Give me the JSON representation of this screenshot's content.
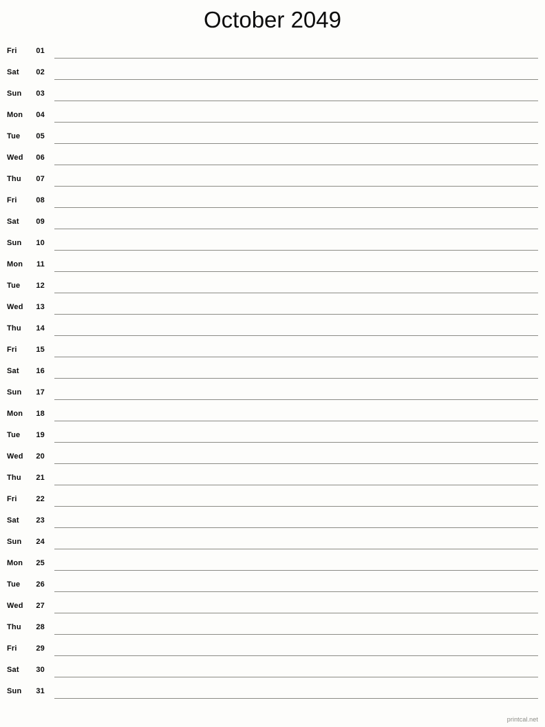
{
  "title": "October 2049",
  "month": "October",
  "year": "2049",
  "footer": {
    "credit": "printcal.net"
  },
  "calendar": {
    "columns": [
      "weekday",
      "day",
      "notes"
    ],
    "rows": [
      {
        "weekday": "Fri",
        "day": "01",
        "note": ""
      },
      {
        "weekday": "Sat",
        "day": "02",
        "note": ""
      },
      {
        "weekday": "Sun",
        "day": "03",
        "note": ""
      },
      {
        "weekday": "Mon",
        "day": "04",
        "note": ""
      },
      {
        "weekday": "Tue",
        "day": "05",
        "note": ""
      },
      {
        "weekday": "Wed",
        "day": "06",
        "note": ""
      },
      {
        "weekday": "Thu",
        "day": "07",
        "note": ""
      },
      {
        "weekday": "Fri",
        "day": "08",
        "note": ""
      },
      {
        "weekday": "Sat",
        "day": "09",
        "note": ""
      },
      {
        "weekday": "Sun",
        "day": "10",
        "note": ""
      },
      {
        "weekday": "Mon",
        "day": "11",
        "note": ""
      },
      {
        "weekday": "Tue",
        "day": "12",
        "note": ""
      },
      {
        "weekday": "Wed",
        "day": "13",
        "note": ""
      },
      {
        "weekday": "Thu",
        "day": "14",
        "note": ""
      },
      {
        "weekday": "Fri",
        "day": "15",
        "note": ""
      },
      {
        "weekday": "Sat",
        "day": "16",
        "note": ""
      },
      {
        "weekday": "Sun",
        "day": "17",
        "note": ""
      },
      {
        "weekday": "Mon",
        "day": "18",
        "note": ""
      },
      {
        "weekday": "Tue",
        "day": "19",
        "note": ""
      },
      {
        "weekday": "Wed",
        "day": "20",
        "note": ""
      },
      {
        "weekday": "Thu",
        "day": "21",
        "note": ""
      },
      {
        "weekday": "Fri",
        "day": "22",
        "note": ""
      },
      {
        "weekday": "Sat",
        "day": "23",
        "note": ""
      },
      {
        "weekday": "Sun",
        "day": "24",
        "note": ""
      },
      {
        "weekday": "Mon",
        "day": "25",
        "note": ""
      },
      {
        "weekday": "Tue",
        "day": "26",
        "note": ""
      },
      {
        "weekday": "Wed",
        "day": "27",
        "note": ""
      },
      {
        "weekday": "Thu",
        "day": "28",
        "note": ""
      },
      {
        "weekday": "Fri",
        "day": "29",
        "note": ""
      },
      {
        "weekday": "Sat",
        "day": "30",
        "note": ""
      },
      {
        "weekday": "Sun",
        "day": "31",
        "note": ""
      }
    ]
  },
  "colors": {
    "page_background": "#fdfdfb",
    "text": "#0a0a0a",
    "rule": "#8b8b85",
    "footer_text": "#8a8a84"
  }
}
